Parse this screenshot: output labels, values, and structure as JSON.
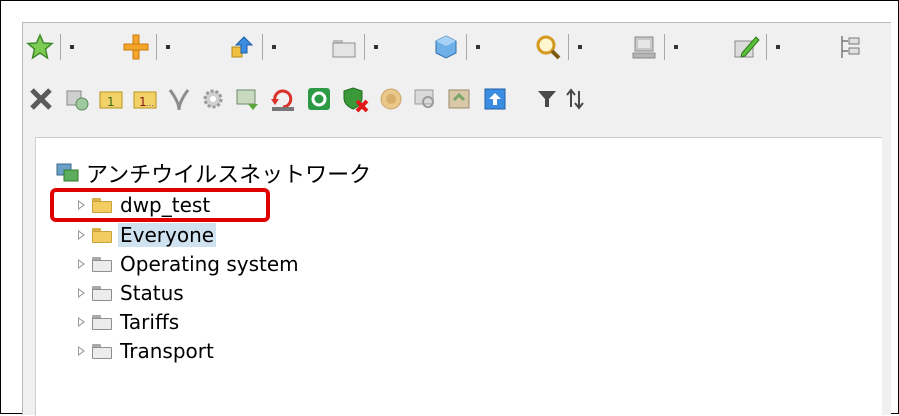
{
  "tree": {
    "root_label": "アンチウイルスネットワーク",
    "nodes": [
      {
        "label": "dwp_test",
        "folder": "yellow",
        "highlight": false
      },
      {
        "label": "Everyone",
        "folder": "yellow",
        "highlight": true
      },
      {
        "label": "Operating system",
        "folder": "gray",
        "highlight": false
      },
      {
        "label": "Status",
        "folder": "gray",
        "highlight": false
      },
      {
        "label": "Tariffs",
        "folder": "gray",
        "highlight": false
      },
      {
        "label": "Transport",
        "folder": "gray",
        "highlight": false
      }
    ]
  },
  "colors": {
    "accent_red": "#e00000",
    "star_green": "#5aa63c",
    "plus_orange": "#f0a020",
    "selection": "#cfe2ef"
  }
}
